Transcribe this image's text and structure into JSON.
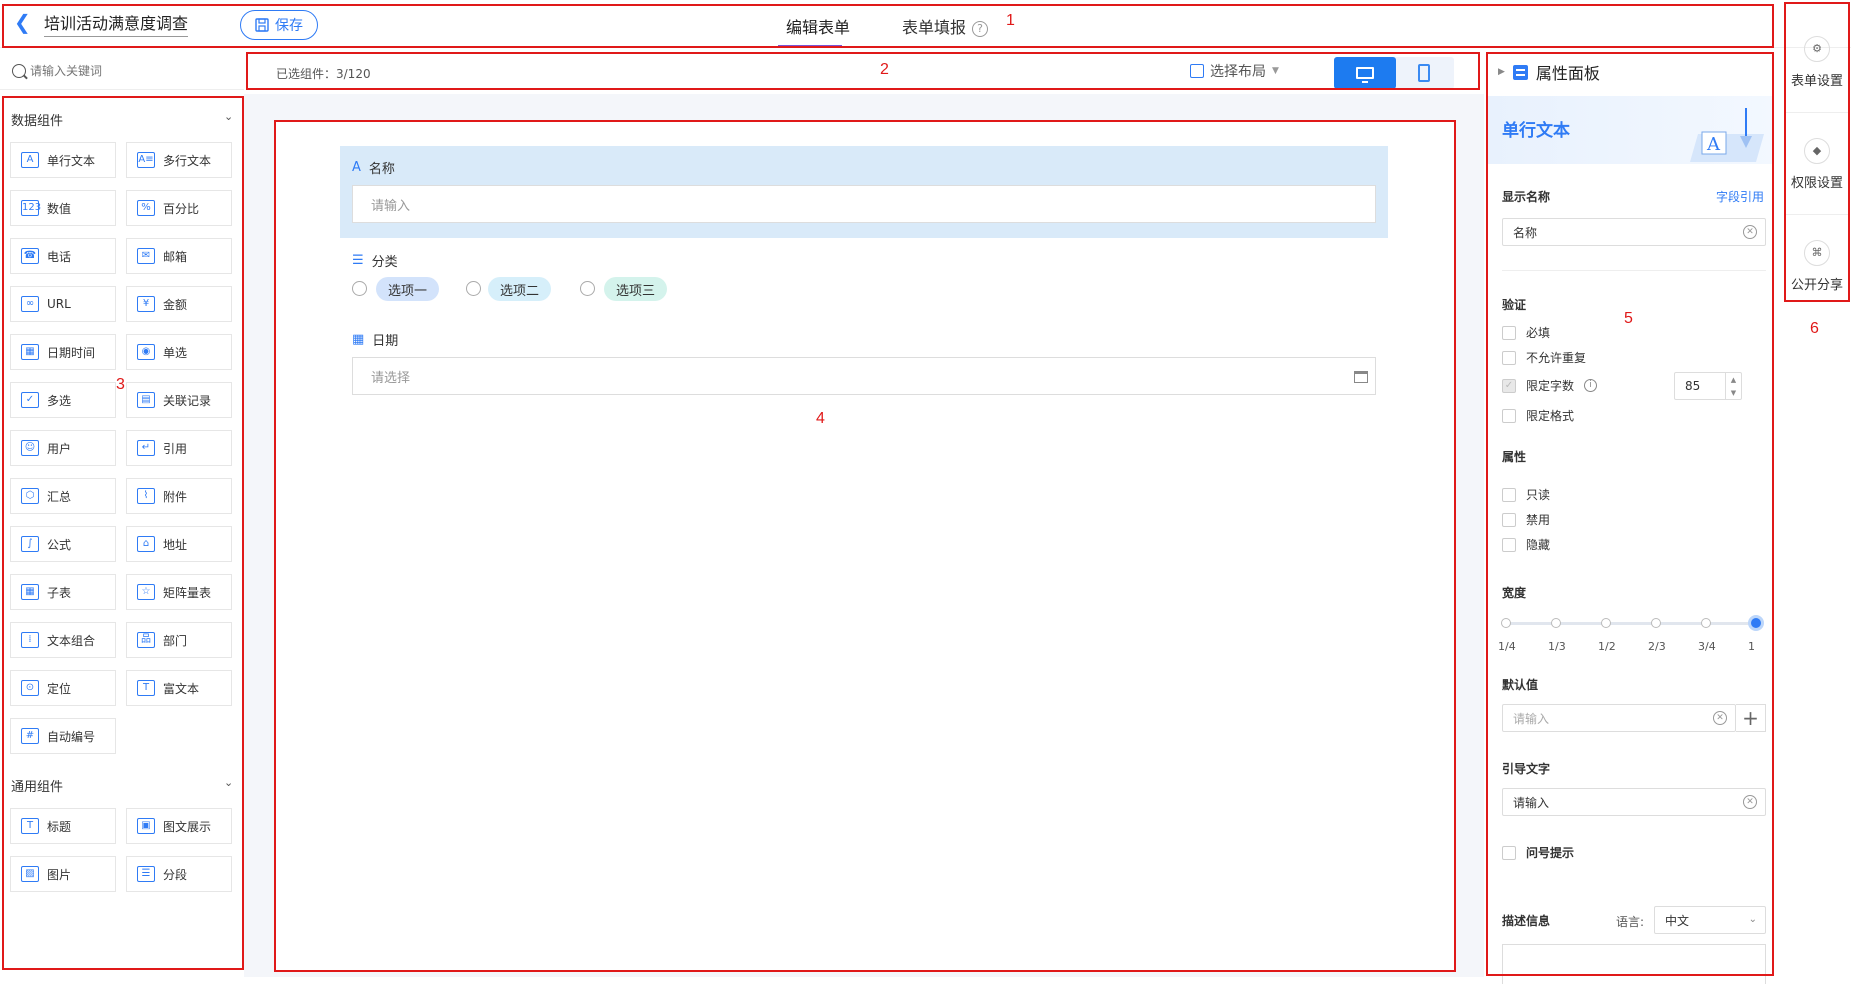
{
  "header": {
    "back_icon": "back-arrow-icon",
    "form_title": "培训活动满意度调查",
    "save_label": "保存",
    "tabs": [
      {
        "label": "编辑表单",
        "active": true
      },
      {
        "label": "表单填报",
        "active": false
      }
    ],
    "help_icon": "question-circle-icon"
  },
  "search": {
    "placeholder": "请输入关键词"
  },
  "sidebar": {
    "data_group": "数据组件",
    "data_components": [
      {
        "label": "单行文本",
        "icon": "A"
      },
      {
        "label": "多行文本",
        "icon": "A≡"
      },
      {
        "label": "数值",
        "icon": "123"
      },
      {
        "label": "百分比",
        "icon": "%"
      },
      {
        "label": "电话",
        "icon": "☎"
      },
      {
        "label": "邮箱",
        "icon": "✉"
      },
      {
        "label": "URL",
        "icon": "∞"
      },
      {
        "label": "金额",
        "icon": "¥"
      },
      {
        "label": "日期时间",
        "icon": "▦"
      },
      {
        "label": "单选",
        "icon": "◉"
      },
      {
        "label": "多选",
        "icon": "✓"
      },
      {
        "label": "关联记录",
        "icon": "▤"
      },
      {
        "label": "用户",
        "icon": "☺"
      },
      {
        "label": "引用",
        "icon": "↵"
      },
      {
        "label": "汇总",
        "icon": "⬡"
      },
      {
        "label": "附件",
        "icon": "⌇"
      },
      {
        "label": "公式",
        "icon": "∫"
      },
      {
        "label": "地址",
        "icon": "⌂"
      },
      {
        "label": "子表",
        "icon": "▦"
      },
      {
        "label": "矩阵量表",
        "icon": "☆"
      },
      {
        "label": "文本组合",
        "icon": "⁞"
      },
      {
        "label": "部门",
        "icon": "品"
      },
      {
        "label": "定位",
        "icon": "⊙"
      },
      {
        "label": "富文本",
        "icon": "T"
      },
      {
        "label": "自动编号",
        "icon": "#"
      }
    ],
    "common_group": "通用组件",
    "common_components": [
      {
        "label": "标题",
        "icon": "T"
      },
      {
        "label": "图文展示",
        "icon": "▣"
      },
      {
        "label": "图片",
        "icon": "▨"
      },
      {
        "label": "分段",
        "icon": "☰"
      }
    ]
  },
  "toolbar": {
    "selected_count": "已选组件：3/120",
    "layout_label": "选择布局",
    "device_desktop": "desktop-icon",
    "device_mobile": "mobile-icon"
  },
  "canvas": {
    "fields": [
      {
        "label": "名称",
        "placeholder": "请输入",
        "icon": "A"
      },
      {
        "label": "分类",
        "options": [
          "选项一",
          "选项二",
          "选项三"
        ],
        "option_colors": [
          "#d3e3fb",
          "#d6effa",
          "#d4f3ec"
        ]
      },
      {
        "label": "日期",
        "placeholder": "请选择"
      }
    ]
  },
  "panel": {
    "title": "属性面板",
    "component_name": "单行文本",
    "display_name_label": "显示名称",
    "field_ref_link": "字段引用",
    "display_name_value": "名称",
    "validation_label": "验证",
    "validation": [
      {
        "label": "必填",
        "checked": false
      },
      {
        "label": "不允许重复",
        "checked": false
      },
      {
        "label": "限定字数",
        "checked": true
      },
      {
        "label": "限定格式",
        "checked": false
      }
    ],
    "char_limit": "85",
    "attributes_label": "属性",
    "attributes": [
      {
        "label": "只读",
        "checked": false
      },
      {
        "label": "禁用",
        "checked": false
      },
      {
        "label": "隐藏",
        "checked": false
      }
    ],
    "width_label": "宽度",
    "width_ticks": [
      "1/4",
      "1/3",
      "1/2",
      "2/3",
      "3/4",
      "1"
    ],
    "width_value": "1",
    "default_label": "默认值",
    "default_placeholder": "请输入",
    "guide_label": "引导文字",
    "guide_value": "请输入",
    "question_hint": "问号提示",
    "desc_label": "描述信息",
    "lang_label": "语言:",
    "lang_value": "中文"
  },
  "far_right": [
    {
      "label": "表单设置",
      "icon": "form-settings-icon"
    },
    {
      "label": "权限设置",
      "icon": "shield-icon"
    },
    {
      "label": "公开分享",
      "icon": "share-icon"
    }
  ],
  "annotations": [
    "1",
    "2",
    "3",
    "4",
    "5",
    "6"
  ]
}
